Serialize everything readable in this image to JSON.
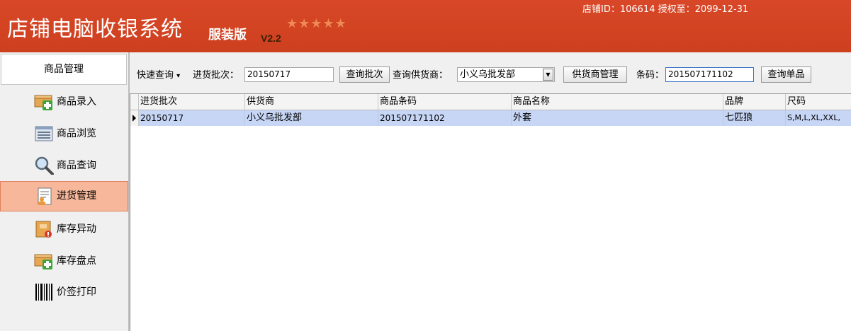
{
  "header": {
    "title": "店铺电脑收银系统",
    "edition": "服装版",
    "version": "V2.2",
    "stars": "★★★★★",
    "store_info": "店铺ID：106614 授权至：2099-12-31"
  },
  "sidebar": {
    "header": "商品管理",
    "items": [
      {
        "label": "商品录入",
        "icon": "box-add-icon"
      },
      {
        "label": "商品浏览",
        "icon": "list-view-icon"
      },
      {
        "label": "商品查询",
        "icon": "magnifier-icon"
      },
      {
        "label": "进货管理",
        "icon": "document-user-icon",
        "active": true
      },
      {
        "label": "库存异动",
        "icon": "inventory-alert-icon"
      },
      {
        "label": "库存盘点",
        "icon": "box-add-icon"
      },
      {
        "label": "价签打印",
        "icon": "barcode-icon"
      }
    ]
  },
  "toolbar": {
    "quick_query_label": "快速查询",
    "quick_query_arrow": "▾",
    "batch_label": "进货批次：",
    "batch_value": "20150717",
    "batch_button": "查询批次",
    "supplier_label": "查询供货商：",
    "supplier_value": "小义乌批发部",
    "supplier_dropdown_glyph": "▼",
    "supplier_manage_button": "供货商管理",
    "barcode_label": "条码：",
    "barcode_value": "201507171102",
    "query_item_button": "查询单品"
  },
  "grid": {
    "columns": [
      "进货批次",
      "供货商",
      "商品条码",
      "商品名称",
      "品牌",
      "尺码"
    ],
    "rows": [
      [
        "20150717",
        "小义乌批发部",
        "201507171102",
        "外套",
        "七匹狼",
        "S,M,L,XL,XXL,"
      ]
    ]
  },
  "colors": {
    "header_bg": "#d24322",
    "active_item_bg": "#f6b79a",
    "selected_row_bg": "#c7d6f5"
  }
}
